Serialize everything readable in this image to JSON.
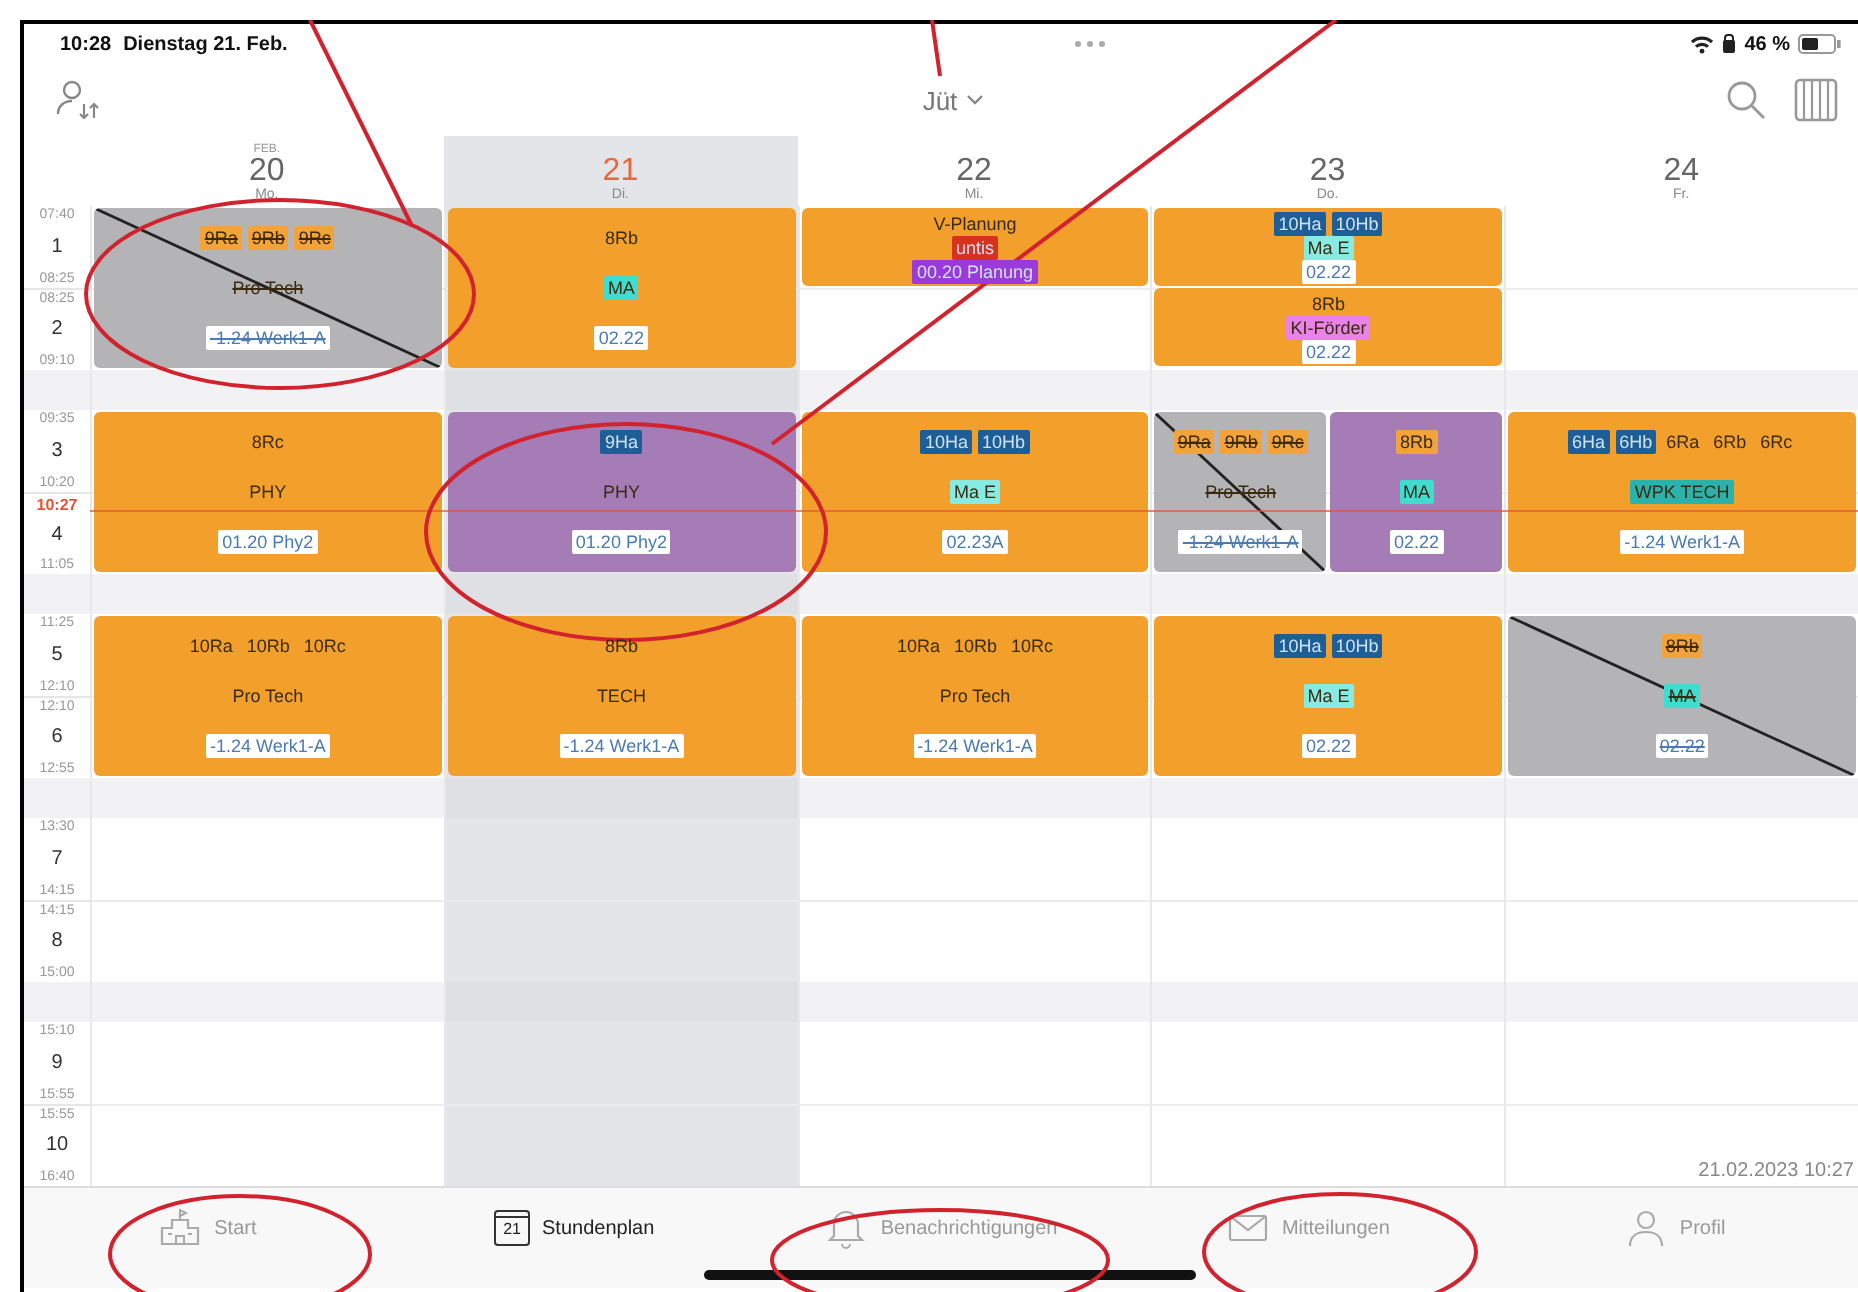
{
  "status_bar": {
    "time": "10:28",
    "date": "Dienstag 21. Feb.",
    "battery": "46 %"
  },
  "toolbar": {
    "title": "Jüt"
  },
  "days": [
    {
      "month": "FEB.",
      "date": "20",
      "weekday": "Mo.",
      "selected": false
    },
    {
      "date": "21",
      "weekday": "Di.",
      "selected": true
    },
    {
      "date": "22",
      "weekday": "Mi.",
      "selected": false
    },
    {
      "date": "23",
      "weekday": "Do.",
      "selected": false
    },
    {
      "date": "24",
      "weekday": "Fr.",
      "selected": false
    }
  ],
  "blocks": [
    {
      "periods": [
        {
          "start": "07:40",
          "number": "1",
          "end": "08:25"
        },
        {
          "start": "08:25",
          "number": "2",
          "end": "09:10"
        }
      ],
      "cells": [
        {
          "kind": "double",
          "lessons": [
            {
              "color": "#b4b4b6",
              "cancelled": true,
              "lines": [
                {
                  "kind": "title",
                  "chips": [
                    {
                      "text": "9Ra",
                      "color": "#f2a33a"
                    },
                    {
                      "text": "9Rb",
                      "color": "#f2a33a"
                    },
                    {
                      "text": "9Rc",
                      "color": "#f2a33a"
                    }
                  ]
                },
                {
                  "kind": "subject",
                  "chips": [
                    {
                      "text": "Pro Tech"
                    }
                  ]
                },
                {
                  "kind": "room",
                  "chips": [
                    {
                      "text": "-1.24 Werk1-A",
                      "color": "#ffffff"
                    }
                  ]
                }
              ]
            }
          ]
        },
        {
          "kind": "double",
          "lessons": [
            {
              "color": "#f29f2b",
              "cancelled": false,
              "lines": [
                {
                  "kind": "title",
                  "chips": [
                    {
                      "text": "8Rb"
                    }
                  ]
                },
                {
                  "kind": "subject",
                  "chips": [
                    {
                      "text": "MA",
                      "color": "#40dccf"
                    }
                  ]
                },
                {
                  "kind": "room",
                  "chips": [
                    {
                      "text": "02.22",
                      "color": "#ffffff"
                    }
                  ]
                }
              ]
            }
          ]
        },
        {
          "kind": "single",
          "first": [
            {
              "color": "#f29f2b",
              "cancelled": false,
              "lines": [
                {
                  "kind": "title",
                  "chips": [
                    {
                      "text": "V-Planung"
                    }
                  ]
                },
                {
                  "kind": "subject",
                  "chips": [
                    {
                      "text": "untis",
                      "color": "#d5331c"
                    }
                  ]
                },
                {
                  "kind": "room",
                  "chips": [
                    {
                      "text": "00.20 Planung",
                      "color": "#9a3ad8"
                    }
                  ]
                }
              ]
            }
          ]
        },
        {
          "kind": "single",
          "first": [
            {
              "color": "#f29f2b",
              "cancelled": false,
              "lines": [
                {
                  "kind": "title",
                  "chips": [
                    {
                      "text": "10Ha",
                      "color": "#1e5e96"
                    },
                    {
                      "text": "10Hb",
                      "color": "#1e5e96"
                    }
                  ]
                },
                {
                  "kind": "subject",
                  "chips": [
                    {
                      "text": "Ma E",
                      "color": "#86ece3"
                    }
                  ]
                },
                {
                  "kind": "room",
                  "chips": [
                    {
                      "text": "02.22",
                      "color": "#ffffff"
                    }
                  ]
                }
              ]
            }
          ],
          "second": [
            {
              "color": "#f29f2b",
              "cancelled": false,
              "lines": [
                {
                  "kind": "title",
                  "chips": [
                    {
                      "text": "8Rb"
                    }
                  ]
                },
                {
                  "kind": "subject",
                  "chips": [
                    {
                      "text": "KI-Förder",
                      "color": "#ea82ea"
                    }
                  ]
                },
                {
                  "kind": "room",
                  "chips": [
                    {
                      "text": "02.22",
                      "color": "#ffffff"
                    }
                  ]
                }
              ]
            }
          ]
        },
        {
          "kind": "empty"
        }
      ]
    },
    {
      "now": "10:27",
      "periods": [
        {
          "start": "09:35",
          "number": "3",
          "end": "10:20"
        },
        {
          "number": "4",
          "end": "11:05"
        }
      ],
      "cells": [
        {
          "kind": "double",
          "lessons": [
            {
              "color": "#f29f2b",
              "cancelled": false,
              "lines": [
                {
                  "kind": "title",
                  "chips": [
                    {
                      "text": "8Rc"
                    }
                  ]
                },
                {
                  "kind": "subject",
                  "chips": [
                    {
                      "text": "PHY"
                    }
                  ]
                },
                {
                  "kind": "room",
                  "chips": [
                    {
                      "text": "01.20 Phy2",
                      "color": "#ffffff"
                    }
                  ]
                }
              ]
            }
          ]
        },
        {
          "kind": "double",
          "lessons": [
            {
              "color": "#a57cb6",
              "cancelled": false,
              "lines": [
                {
                  "kind": "title",
                  "chips": [
                    {
                      "text": "9Ha",
                      "color": "#1e5e96"
                    }
                  ]
                },
                {
                  "kind": "subject",
                  "chips": [
                    {
                      "text": "PHY"
                    }
                  ]
                },
                {
                  "kind": "room",
                  "chips": [
                    {
                      "text": "01.20 Phy2",
                      "color": "#ffffff"
                    }
                  ]
                }
              ]
            }
          ]
        },
        {
          "kind": "double",
          "lessons": [
            {
              "color": "#f29f2b",
              "cancelled": false,
              "lines": [
                {
                  "kind": "title",
                  "chips": [
                    {
                      "text": "10Ha",
                      "color": "#1e5e96"
                    },
                    {
                      "text": "10Hb",
                      "color": "#1e5e96"
                    }
                  ]
                },
                {
                  "kind": "subject",
                  "chips": [
                    {
                      "text": "Ma E",
                      "color": "#86ece3"
                    }
                  ]
                },
                {
                  "kind": "room",
                  "chips": [
                    {
                      "text": "02.23A",
                      "color": "#ffffff"
                    }
                  ]
                }
              ]
            }
          ]
        },
        {
          "kind": "double",
          "lessons": [
            {
              "color": "#b4b4b6",
              "cancelled": true,
              "lines": [
                {
                  "kind": "title",
                  "chips": [
                    {
                      "text": "9Ra",
                      "color": "#f2a33a"
                    },
                    {
                      "text": "9Rb",
                      "color": "#f2a33a"
                    },
                    {
                      "text": "9Rc",
                      "color": "#f2a33a"
                    }
                  ]
                },
                {
                  "kind": "subject",
                  "chips": [
                    {
                      "text": "Pro Tech"
                    }
                  ]
                },
                {
                  "kind": "room",
                  "chips": [
                    {
                      "text": "-1.24 Werk1-A",
                      "color": "#ffffff"
                    }
                  ]
                }
              ]
            },
            {
              "color": "#a57cb6",
              "cancelled": false,
              "lines": [
                {
                  "kind": "title",
                  "chips": [
                    {
                      "text": "8Rb",
                      "color": "#f2a33a"
                    }
                  ]
                },
                {
                  "kind": "subject",
                  "chips": [
                    {
                      "text": "MA",
                      "color": "#40dccf"
                    }
                  ]
                },
                {
                  "kind": "room",
                  "chips": [
                    {
                      "text": "02.22",
                      "color": "#ffffff"
                    }
                  ]
                }
              ]
            }
          ]
        },
        {
          "kind": "double",
          "lessons": [
            {
              "color": "#f29f2b",
              "cancelled": false,
              "lines": [
                {
                  "kind": "title",
                  "chips": [
                    {
                      "text": "6Ha",
                      "color": "#1e5e96"
                    },
                    {
                      "text": "6Hb",
                      "color": "#1e5e96"
                    },
                    {
                      "text": "6Ra"
                    },
                    {
                      "text": "6Rb"
                    },
                    {
                      "text": "6Rc"
                    }
                  ]
                },
                {
                  "kind": "subject",
                  "chips": [
                    {
                      "text": "WPK TECH",
                      "color": "#2ab3ad"
                    }
                  ]
                },
                {
                  "kind": "room",
                  "chips": [
                    {
                      "text": "-1.24 Werk1-A",
                      "color": "#ffffff"
                    }
                  ]
                }
              ]
            }
          ]
        }
      ]
    },
    {
      "periods": [
        {
          "start": "11:25",
          "number": "5",
          "end": "12:10"
        },
        {
          "start": "12:10",
          "number": "6",
          "end": "12:55"
        }
      ],
      "cells": [
        {
          "kind": "double",
          "lessons": [
            {
              "color": "#f29f2b",
              "cancelled": false,
              "lines": [
                {
                  "kind": "title",
                  "chips": [
                    {
                      "text": "10Ra"
                    },
                    {
                      "text": "10Rb"
                    },
                    {
                      "text": "10Rc"
                    }
                  ]
                },
                {
                  "kind": "subject",
                  "chips": [
                    {
                      "text": "Pro Tech"
                    }
                  ]
                },
                {
                  "kind": "room",
                  "chips": [
                    {
                      "text": "-1.24 Werk1-A",
                      "color": "#ffffff"
                    }
                  ]
                }
              ]
            }
          ]
        },
        {
          "kind": "double",
          "lessons": [
            {
              "color": "#f29f2b",
              "cancelled": false,
              "lines": [
                {
                  "kind": "title",
                  "chips": [
                    {
                      "text": "8Rb"
                    }
                  ]
                },
                {
                  "kind": "subject",
                  "chips": [
                    {
                      "text": "TECH"
                    }
                  ]
                },
                {
                  "kind": "room",
                  "chips": [
                    {
                      "text": "-1.24 Werk1-A",
                      "color": "#ffffff"
                    }
                  ]
                }
              ]
            }
          ]
        },
        {
          "kind": "double",
          "lessons": [
            {
              "color": "#f29f2b",
              "cancelled": false,
              "lines": [
                {
                  "kind": "title",
                  "chips": [
                    {
                      "text": "10Ra"
                    },
                    {
                      "text": "10Rb"
                    },
                    {
                      "text": "10Rc"
                    }
                  ]
                },
                {
                  "kind": "subject",
                  "chips": [
                    {
                      "text": "Pro Tech"
                    }
                  ]
                },
                {
                  "kind": "room",
                  "chips": [
                    {
                      "text": "-1.24 Werk1-A",
                      "color": "#ffffff"
                    }
                  ]
                }
              ]
            }
          ]
        },
        {
          "kind": "double",
          "lessons": [
            {
              "color": "#f29f2b",
              "cancelled": false,
              "lines": [
                {
                  "kind": "title",
                  "chips": [
                    {
                      "text": "10Ha",
                      "color": "#1e5e96"
                    },
                    {
                      "text": "10Hb",
                      "color": "#1e5e96"
                    }
                  ]
                },
                {
                  "kind": "subject",
                  "chips": [
                    {
                      "text": "Ma E",
                      "color": "#86ece3"
                    }
                  ]
                },
                {
                  "kind": "room",
                  "chips": [
                    {
                      "text": "02.22",
                      "color": "#ffffff"
                    }
                  ]
                }
              ]
            }
          ]
        },
        {
          "kind": "double",
          "lessons": [
            {
              "color": "#b4b4b6",
              "cancelled": true,
              "lines": [
                {
                  "kind": "title",
                  "chips": [
                    {
                      "text": "8Rb",
                      "color": "#f2a33a"
                    }
                  ]
                },
                {
                  "kind": "subject",
                  "chips": [
                    {
                      "text": "MA",
                      "color": "#40dccf"
                    }
                  ]
                },
                {
                  "kind": "room",
                  "chips": [
                    {
                      "text": "02.22",
                      "color": "#ffffff"
                    }
                  ]
                }
              ]
            }
          ]
        }
      ]
    },
    {
      "periods": [
        {
          "start": "13:30",
          "number": "7",
          "end": "14:15"
        },
        {
          "start": "14:15",
          "number": "8",
          "end": "15:00"
        }
      ],
      "cells": [
        {
          "kind": "empty"
        },
        {
          "kind": "empty"
        },
        {
          "kind": "empty"
        },
        {
          "kind": "empty"
        },
        {
          "kind": "empty"
        }
      ]
    },
    {
      "periods": [
        {
          "start": "15:10",
          "number": "9",
          "end": "15:55"
        },
        {
          "start": "15:55",
          "number": "10",
          "end": "16:40"
        }
      ],
      "cells": [
        {
          "kind": "empty"
        },
        {
          "kind": "empty"
        },
        {
          "kind": "empty"
        },
        {
          "kind": "empty"
        },
        {
          "kind": "empty"
        }
      ]
    }
  ],
  "timestamp": "21.02.2023 10:27",
  "tabs": [
    {
      "label": "Start",
      "selected": false
    },
    {
      "label": "Stundenplan",
      "icon_text": "21",
      "selected": true
    },
    {
      "label": "Benachrichtigungen",
      "selected": false
    },
    {
      "label": "Mitteilungen",
      "selected": false
    },
    {
      "label": "Profil",
      "selected": false
    }
  ]
}
